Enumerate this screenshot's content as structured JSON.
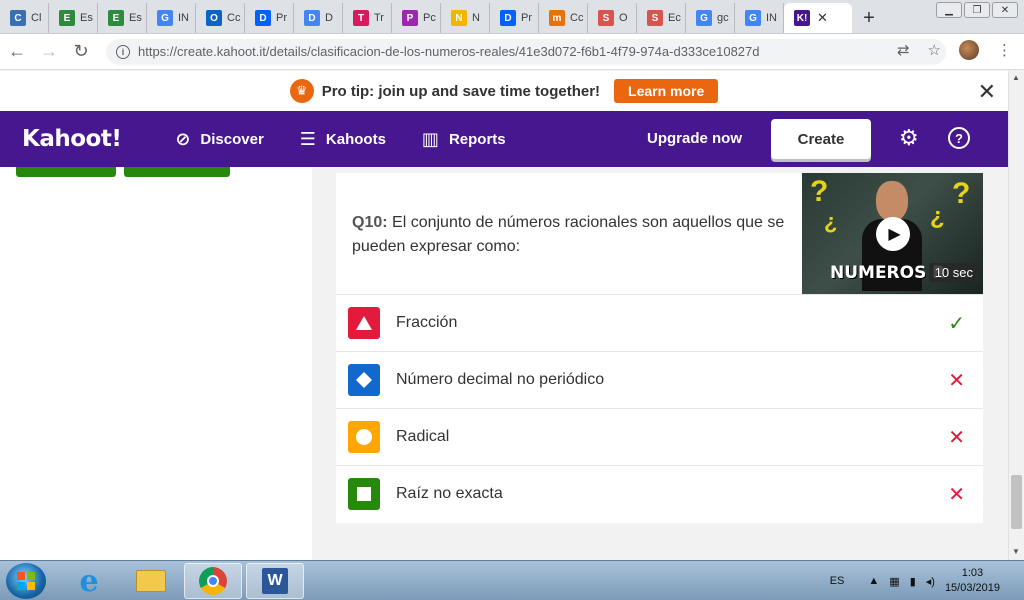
{
  "browser": {
    "tabs": [
      {
        "label": "Cl",
        "icon": "classroom-icon",
        "color": "#3a6fb0",
        "glyph": "C"
      },
      {
        "label": "Es",
        "icon": "sheets-chart-icon",
        "color": "#2e8b3e",
        "glyph": "E"
      },
      {
        "label": "Es",
        "icon": "sheets-chart-icon",
        "color": "#2e8b3e",
        "glyph": "E"
      },
      {
        "label": "IN",
        "icon": "google-icon",
        "color": "#4285f4",
        "glyph": "G"
      },
      {
        "label": "Cc",
        "icon": "outlook-icon",
        "color": "#0a64c8",
        "glyph": "O"
      },
      {
        "label": "Pr",
        "icon": "dropbox-icon",
        "color": "#0061fe",
        "glyph": "D"
      },
      {
        "label": "D",
        "icon": "docs-icon",
        "color": "#4285f4",
        "glyph": "D"
      },
      {
        "label": "Tr",
        "icon": "contact-icon",
        "color": "#d81b60",
        "glyph": "T"
      },
      {
        "label": "Pc",
        "icon": "slides-icon",
        "color": "#9c27b0",
        "glyph": "P"
      },
      {
        "label": "N",
        "icon": "drive-icon",
        "color": "#f4b400",
        "glyph": "N"
      },
      {
        "label": "Pr",
        "icon": "dropbox-icon",
        "color": "#0061fe",
        "glyph": "D"
      },
      {
        "label": "Cc",
        "icon": "m-icon",
        "color": "#e8710a",
        "glyph": "m"
      },
      {
        "label": "O",
        "icon": "s-icon",
        "color": "#d9534f",
        "glyph": "S"
      },
      {
        "label": "Ec",
        "icon": "s-icon",
        "color": "#d9534f",
        "glyph": "S"
      },
      {
        "label": "gc",
        "icon": "google-icon",
        "color": "#4285f4",
        "glyph": "G"
      },
      {
        "label": "IN",
        "icon": "google-icon",
        "color": "#4285f4",
        "glyph": "G"
      }
    ],
    "active_tab": {
      "label": "K!",
      "icon": "kahoot-icon",
      "color": "#46178f"
    },
    "new_tab_label": "+",
    "url": "https://create.kahoot.it/details/clasificacion-de-los-numeros-reales/41e3d072-f6b1-4f79-974a-d333ce10827d"
  },
  "banner": {
    "text": "Pro tip: join up and save time together!",
    "button": "Learn more",
    "accent": "#eb670f"
  },
  "nav": {
    "logo": "Kahoot!",
    "discover": "Discover",
    "kahoots": "Kahoots",
    "reports": "Reports",
    "upgrade": "Upgrade now",
    "create": "Create",
    "brand_color": "#46178f"
  },
  "question": {
    "prefix": "Q10:",
    "text": "El conjunto de números racionales son aquellos que se pueden expresar como:",
    "video_title": "NUMEROS R",
    "duration": "10 sec"
  },
  "answers": [
    {
      "text": "Fracción",
      "shape": "triangle-icon",
      "color": "#e21b3c",
      "correct": true
    },
    {
      "text": "Número decimal no periódico",
      "shape": "diamond-icon",
      "color": "#1368ce",
      "correct": false
    },
    {
      "text": "Radical",
      "shape": "circle-icon",
      "color": "#ffa602",
      "correct": false
    },
    {
      "text": "Raíz no exacta",
      "shape": "square-icon",
      "color": "#26890c",
      "correct": false
    }
  ],
  "taskbar": {
    "language": "ES",
    "time": "1:03",
    "date": "15/03/2019"
  }
}
